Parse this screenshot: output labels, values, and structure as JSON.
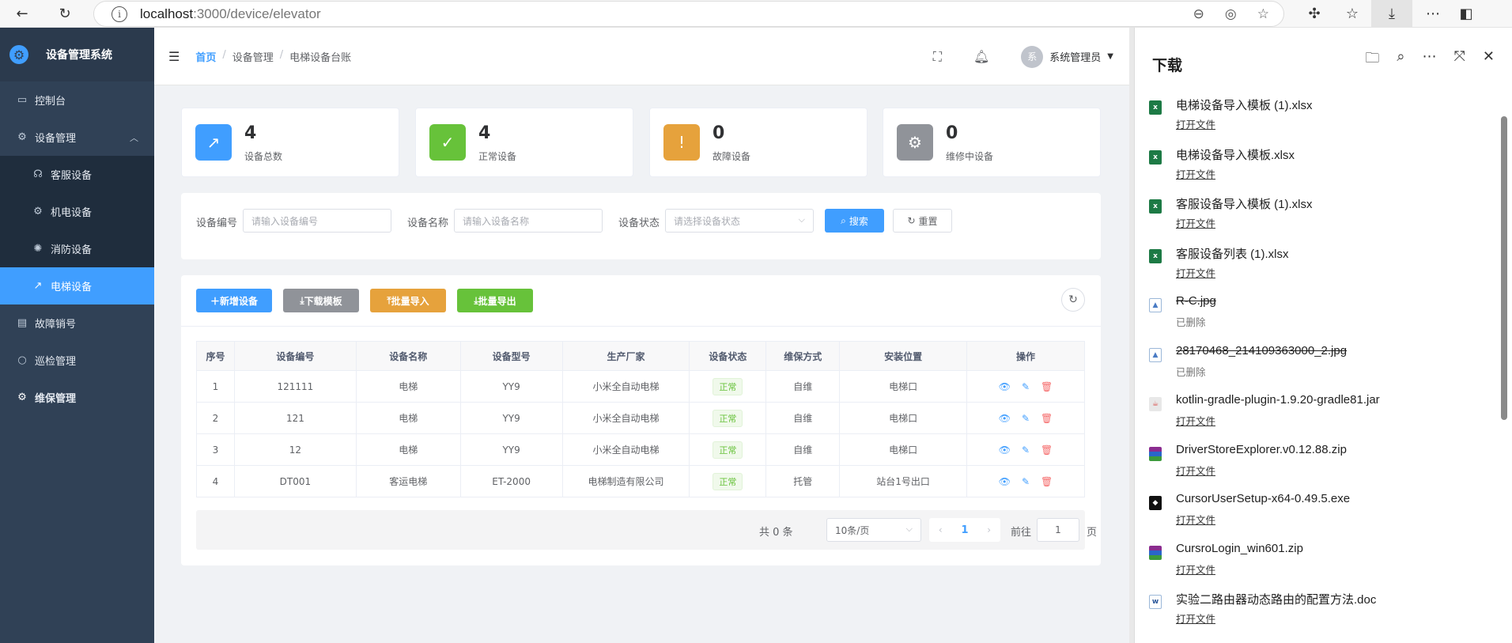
{
  "browser": {
    "url_host": "localhost",
    "url_path": ":3000/device/elevator"
  },
  "sidebar": {
    "title": "设备管理系统",
    "items": [
      {
        "label": "控制台",
        "icon": "monitor-icon"
      },
      {
        "label": "设备管理",
        "icon": "gear-icon"
      },
      {
        "label": "客服设备",
        "icon": "headset-icon"
      },
      {
        "label": "机电设备",
        "icon": "gear-icon"
      },
      {
        "label": "消防设备",
        "icon": "aperture-icon"
      },
      {
        "label": "电梯设备",
        "icon": "arrow-up-right-icon"
      },
      {
        "label": "故障销号",
        "icon": "document-icon"
      },
      {
        "label": "巡检管理",
        "icon": "search-icon"
      },
      {
        "label": "维保管理",
        "icon": "gear-icon"
      }
    ]
  },
  "header": {
    "breadcrumbs": [
      "首页",
      "设备管理",
      "电梯设备台账"
    ],
    "separator": "/",
    "user_avatar": "系",
    "user_name": "系统管理员"
  },
  "stats": [
    {
      "value": "4",
      "label": "设备总数",
      "color": "#409eff"
    },
    {
      "value": "4",
      "label": "正常设备",
      "color": "#67c23a"
    },
    {
      "value": "0",
      "label": "故障设备",
      "color": "#e6a23c"
    },
    {
      "value": "0",
      "label": "维修中设备",
      "color": "#909399"
    }
  ],
  "search": {
    "code_label": "设备编号",
    "code_placeholder": "请输入设备编号",
    "name_label": "设备名称",
    "name_placeholder": "请输入设备名称",
    "status_label": "设备状态",
    "status_placeholder": "请选择设备状态",
    "search_btn": "搜索",
    "reset_btn": "重置"
  },
  "toolbar": {
    "add": "新增设备",
    "download": "下载模板",
    "import": "批量导入",
    "export": "批量导出"
  },
  "table": {
    "headers": [
      "序号",
      "设备编号",
      "设备名称",
      "设备型号",
      "生产厂家",
      "设备状态",
      "维保方式",
      "安装位置",
      "操作"
    ],
    "rows": [
      {
        "idx": "1",
        "code": "121111",
        "name": "电梯",
        "model": "YY9",
        "maker": "小米全自动电梯",
        "status": "正常",
        "maint": "自维",
        "location": "电梯口"
      },
      {
        "idx": "2",
        "code": "121",
        "name": "电梯",
        "model": "YY9",
        "maker": "小米全自动电梯",
        "status": "正常",
        "maint": "自维",
        "location": "电梯口"
      },
      {
        "idx": "3",
        "code": "12",
        "name": "电梯",
        "model": "YY9",
        "maker": "小米全自动电梯",
        "status": "正常",
        "maint": "自维",
        "location": "电梯口"
      },
      {
        "idx": "4",
        "code": "DT001",
        "name": "客运电梯",
        "model": "ET-2000",
        "maker": "电梯制造有限公司",
        "status": "正常",
        "maint": "托管",
        "location": "站台1号出口"
      }
    ]
  },
  "pager": {
    "total": "共 0 条",
    "page_size": "10条/页",
    "current": "1",
    "goto_label": "前往",
    "goto_value": "1",
    "unit": "页"
  },
  "downloads": {
    "title": "下载",
    "items": [
      {
        "name": "电梯设备导入模板 (1).xlsx",
        "action": "打开文件",
        "type": "excel",
        "deleted": false
      },
      {
        "name": "电梯设备导入模板.xlsx",
        "action": "打开文件",
        "type": "excel",
        "deleted": false
      },
      {
        "name": "客服设备导入模板 (1).xlsx",
        "action": "打开文件",
        "type": "excel",
        "deleted": false
      },
      {
        "name": "客服设备列表 (1).xlsx",
        "action": "打开文件",
        "type": "excel",
        "deleted": false
      },
      {
        "name": "R-C.jpg",
        "action": "已删除",
        "type": "image",
        "deleted": true
      },
      {
        "name": "28170468_214109363000_2.jpg",
        "action": "已删除",
        "type": "image",
        "deleted": true
      },
      {
        "name": "kotlin-gradle-plugin-1.9.20-gradle81.jar",
        "action": "打开文件",
        "type": "jar",
        "deleted": false
      },
      {
        "name": "DriverStoreExplorer.v0.12.88.zip",
        "action": "打开文件",
        "type": "zip",
        "deleted": false
      },
      {
        "name": "CursorUserSetup-x64-0.49.5.exe",
        "action": "打开文件",
        "type": "exe",
        "deleted": false
      },
      {
        "name": "CursroLogin_win601.zip",
        "action": "打开文件",
        "type": "zip",
        "deleted": false
      },
      {
        "name": "实验二路由器动态路由的配置方法.doc",
        "action": "打开文件",
        "type": "doc",
        "deleted": false
      }
    ]
  }
}
